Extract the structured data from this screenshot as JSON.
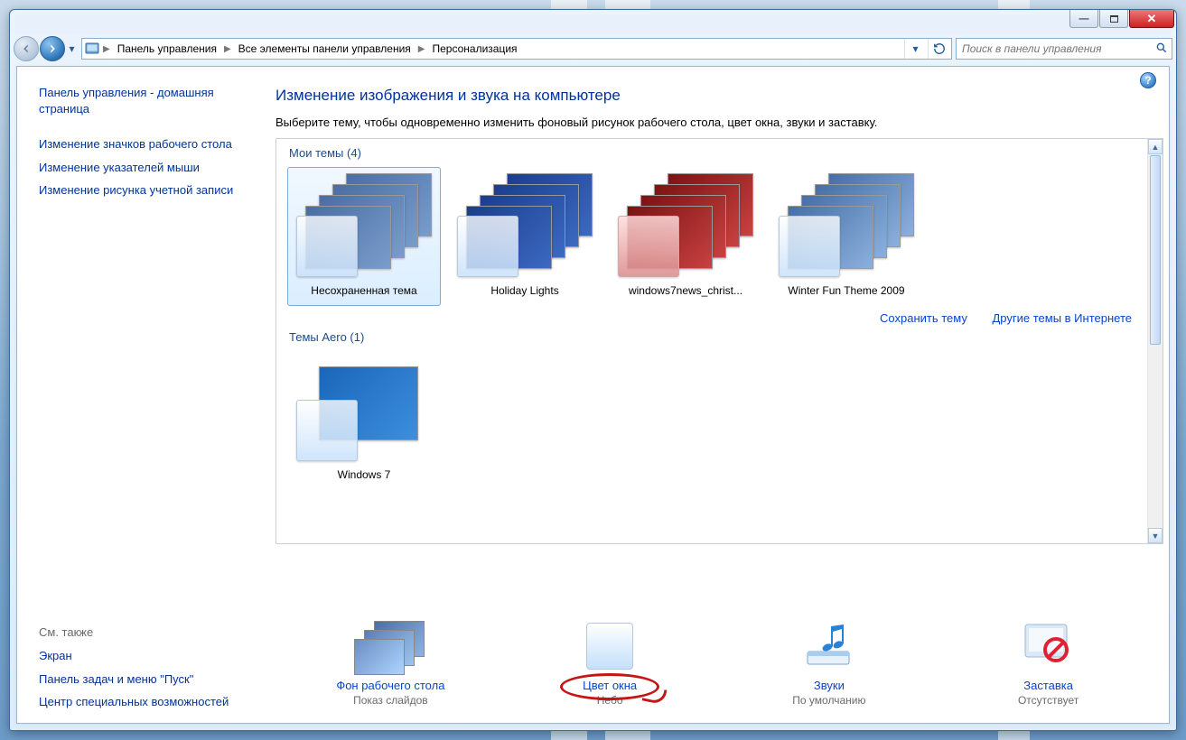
{
  "breadcrumbs": [
    "Панель управления",
    "Все элементы панели управления",
    "Персонализация"
  ],
  "search": {
    "placeholder": "Поиск в панели управления"
  },
  "sidebar": {
    "home": "Панель управления - домашняя страница",
    "links": [
      "Изменение значков рабочего стола",
      "Изменение указателей мыши",
      "Изменение рисунка учетной записи"
    ],
    "see_also_label": "См. также",
    "see_also": [
      "Экран",
      "Панель задач и меню \"Пуск\"",
      "Центр специальных возможностей"
    ]
  },
  "main": {
    "title": "Изменение изображения и звука на компьютере",
    "desc": "Выберите тему, чтобы одновременно изменить фоновый рисунок рабочего стола, цвет окна, звуки и заставку.",
    "my_themes_label": "Мои темы (4)",
    "aero_label": "Темы Aero (1)",
    "save_theme": "Сохранить тему",
    "more_online": "Другие темы в Интернете",
    "themes": [
      {
        "name": "Несохраненная тема"
      },
      {
        "name": "Holiday Lights"
      },
      {
        "name": "windows7news_christ..."
      },
      {
        "name": "Winter Fun Theme 2009"
      }
    ],
    "aero_themes": [
      {
        "name": "Windows 7"
      }
    ]
  },
  "bottom": [
    {
      "link": "Фон рабочего стола",
      "sub": "Показ слайдов"
    },
    {
      "link": "Цвет окна",
      "sub": "Небо"
    },
    {
      "link": "Звуки",
      "sub": "По умолчанию"
    },
    {
      "link": "Заставка",
      "sub": "Отсутствует"
    }
  ]
}
